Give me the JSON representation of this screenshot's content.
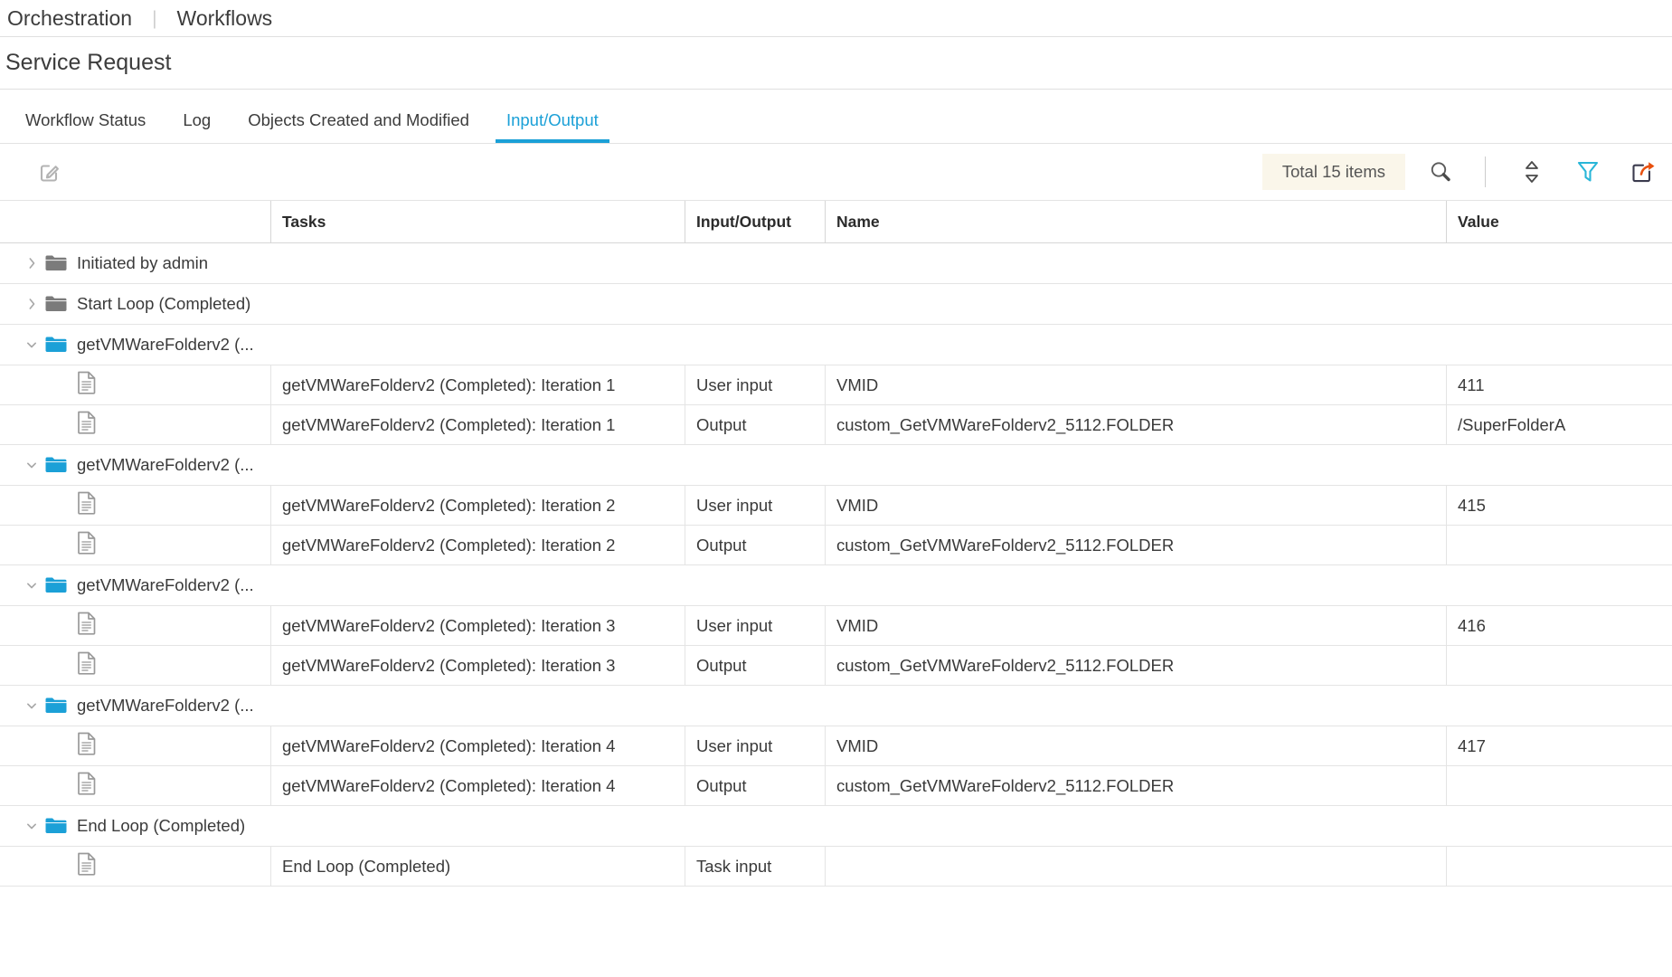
{
  "breadcrumb": {
    "items": [
      "Orchestration",
      "Workflows"
    ],
    "separator": "|"
  },
  "page": {
    "title": "Service Request"
  },
  "tabs": [
    {
      "label": "Workflow Status",
      "active": false
    },
    {
      "label": "Log",
      "active": false
    },
    {
      "label": "Objects Created and Modified",
      "active": false
    },
    {
      "label": "Input/Output",
      "active": true
    }
  ],
  "toolbar": {
    "edit_icon": "edit-pencil-icon",
    "total_items": "Total 15 items",
    "search_icon": "search-icon",
    "sort_icon": "sort-icon",
    "filter_icon": "filter-icon",
    "export_icon": "export-icon",
    "colors": {
      "accent": "#1ba0d7",
      "filter": "#29b6d8",
      "export_arrow": "#e8500e",
      "badge_bg": "#faf6ea",
      "folder_open": "#1ba0d7",
      "folder_closed": "#7b7b7b"
    }
  },
  "table": {
    "columns": [
      "",
      "Tasks",
      "Input/Output",
      "Name",
      "Value"
    ],
    "rows": [
      {
        "kind": "group",
        "expanded": false,
        "label": "Initiated by admin",
        "task": "",
        "io": "",
        "name": "",
        "value": ""
      },
      {
        "kind": "group",
        "expanded": false,
        "label": "Start Loop (Completed)",
        "task": "",
        "io": "",
        "name": "",
        "value": ""
      },
      {
        "kind": "group",
        "expanded": true,
        "label": "getVMWareFolderv2 (...",
        "task": "",
        "io": "",
        "name": "",
        "value": ""
      },
      {
        "kind": "leaf",
        "label": "",
        "task": "getVMWareFolderv2 (Completed): Iteration 1",
        "io": "User input",
        "name": "VMID",
        "value": "411"
      },
      {
        "kind": "leaf",
        "label": "",
        "task": "getVMWareFolderv2 (Completed): Iteration 1",
        "io": "Output",
        "name": "custom_GetVMWareFolderv2_5112.FOLDER",
        "value": "/SuperFolderA"
      },
      {
        "kind": "group",
        "expanded": true,
        "label": "getVMWareFolderv2 (...",
        "task": "",
        "io": "",
        "name": "",
        "value": ""
      },
      {
        "kind": "leaf",
        "label": "",
        "task": "getVMWareFolderv2 (Completed): Iteration 2",
        "io": "User input",
        "name": "VMID",
        "value": "415"
      },
      {
        "kind": "leaf",
        "label": "",
        "task": "getVMWareFolderv2 (Completed): Iteration 2",
        "io": "Output",
        "name": "custom_GetVMWareFolderv2_5112.FOLDER",
        "value": ""
      },
      {
        "kind": "group",
        "expanded": true,
        "label": "getVMWareFolderv2 (...",
        "task": "",
        "io": "",
        "name": "",
        "value": ""
      },
      {
        "kind": "leaf",
        "label": "",
        "task": "getVMWareFolderv2 (Completed): Iteration 3",
        "io": "User input",
        "name": "VMID",
        "value": "416"
      },
      {
        "kind": "leaf",
        "label": "",
        "task": "getVMWareFolderv2 (Completed): Iteration 3",
        "io": "Output",
        "name": "custom_GetVMWareFolderv2_5112.FOLDER",
        "value": ""
      },
      {
        "kind": "group",
        "expanded": true,
        "label": "getVMWareFolderv2 (...",
        "task": "",
        "io": "",
        "name": "",
        "value": ""
      },
      {
        "kind": "leaf",
        "label": "",
        "task": "getVMWareFolderv2 (Completed): Iteration 4",
        "io": "User input",
        "name": "VMID",
        "value": "417"
      },
      {
        "kind": "leaf",
        "label": "",
        "task": "getVMWareFolderv2 (Completed): Iteration 4",
        "io": "Output",
        "name": "custom_GetVMWareFolderv2_5112.FOLDER",
        "value": ""
      },
      {
        "kind": "group",
        "expanded": true,
        "label": "End Loop (Completed)",
        "task": "",
        "io": "",
        "name": "",
        "value": ""
      },
      {
        "kind": "leaf",
        "label": "",
        "task": "End Loop (Completed)",
        "io": "Task input",
        "name": "",
        "value": ""
      }
    ]
  }
}
